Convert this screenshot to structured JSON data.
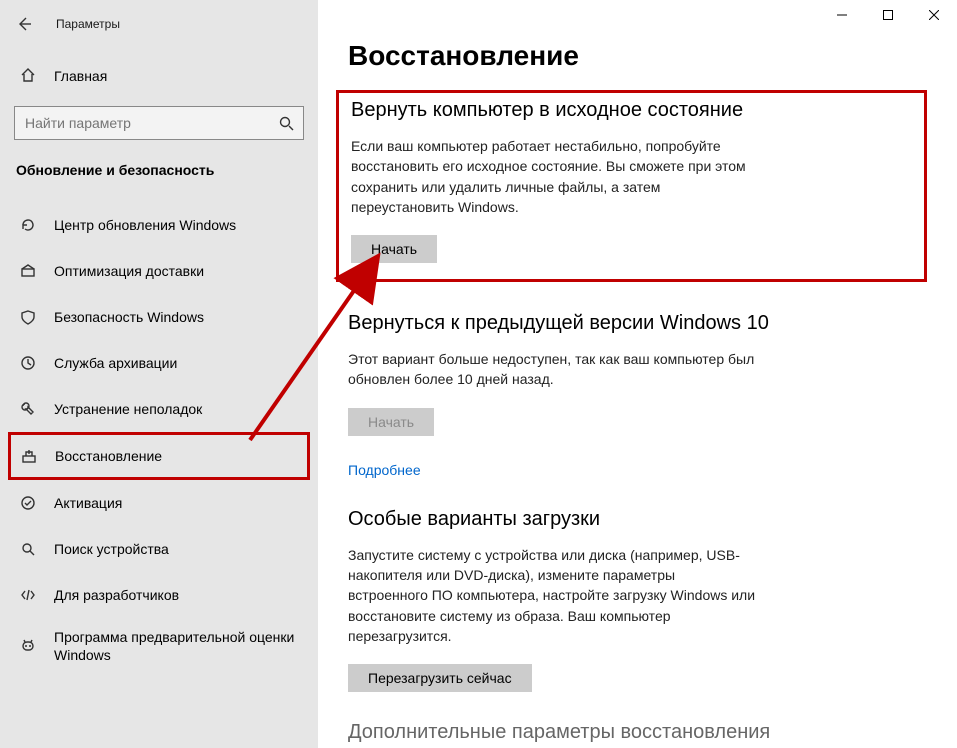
{
  "window": {
    "title": "Параметры"
  },
  "sidebar": {
    "home_label": "Главная",
    "search_placeholder": "Найти параметр",
    "category_title": "Обновление и безопасность",
    "items": [
      {
        "label": "Центр обновления Windows",
        "icon": "update-icon"
      },
      {
        "label": "Оптимизация доставки",
        "icon": "delivery-icon"
      },
      {
        "label": "Безопасность Windows",
        "icon": "shield-icon"
      },
      {
        "label": "Служба архивации",
        "icon": "backup-icon"
      },
      {
        "label": "Устранение неполадок",
        "icon": "troubleshoot-icon"
      },
      {
        "label": "Восстановление",
        "icon": "recovery-icon"
      },
      {
        "label": "Активация",
        "icon": "activation-icon"
      },
      {
        "label": "Поиск устройства",
        "icon": "find-device-icon"
      },
      {
        "label": "Для разработчиков",
        "icon": "developer-icon"
      },
      {
        "label": "Программа предварительной оценки Windows",
        "icon": "insider-icon"
      }
    ]
  },
  "main": {
    "page_title": "Восстановление",
    "reset": {
      "heading": "Вернуть компьютер в исходное состояние",
      "body": "Если ваш компьютер работает нестабильно, попробуйте восстановить его исходное состояние. Вы сможете при этом сохранить или удалить личные файлы, а затем переустановить Windows.",
      "button": "Начать"
    },
    "goback": {
      "heading": "Вернуться к предыдущей версии Windows 10",
      "body": "Этот вариант больше недоступен, так как ваш компьютер был обновлен более 10 дней назад.",
      "button": "Начать",
      "learn_more": "Подробнее"
    },
    "advanced": {
      "heading": "Особые варианты загрузки",
      "body": "Запустите систему с устройства или диска (например, USB-накопителя или DVD-диска), измените параметры встроенного ПО компьютера, настройте загрузку Windows или восстановите систему из образа. Ваш компьютер перезагрузится.",
      "button": "Перезагрузить сейчас"
    },
    "truncated_heading": "Дополнительные параметры восстановления"
  }
}
